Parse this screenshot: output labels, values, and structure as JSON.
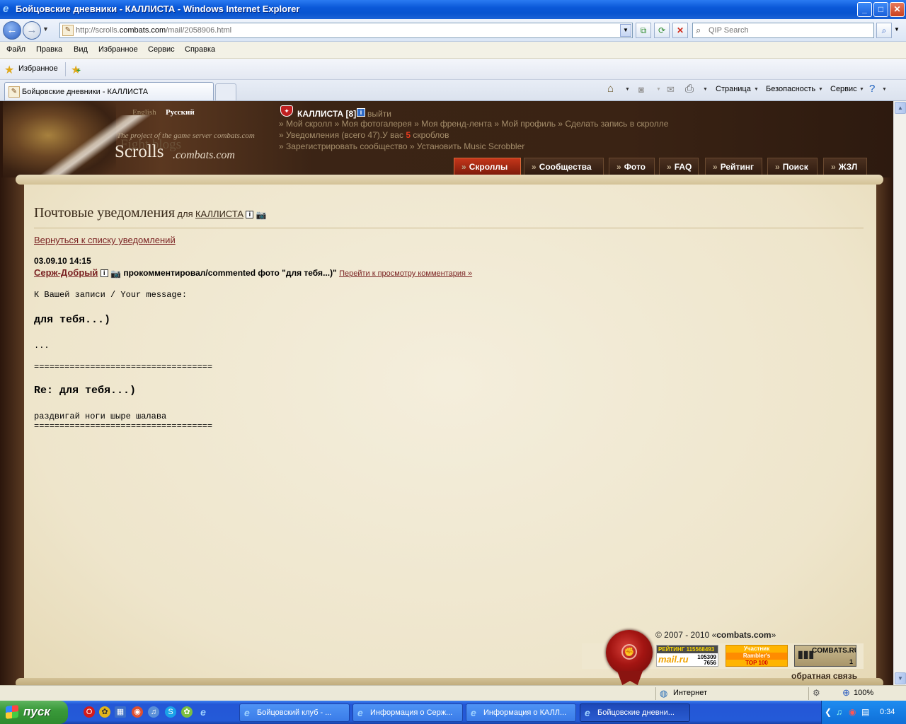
{
  "window": {
    "title": "Бойцовские дневники - КАЛЛИСТА - Windows Internet Explorer",
    "minimize": "_",
    "maximize": "□",
    "close": "✕"
  },
  "address": {
    "url_prefix": "http://scrolls.",
    "url_domain": "combats.com",
    "url_suffix": "/mail/2058906.html",
    "search_placeholder": "QIP Search"
  },
  "menu": [
    "Файл",
    "Правка",
    "Вид",
    "Избранное",
    "Сервис",
    "Справка"
  ],
  "favorites": {
    "label": "Избранное"
  },
  "tabs": [
    {
      "label": "Бойцовские дневники - КАЛЛИСТА"
    }
  ],
  "commandbar": {
    "page": "Страница",
    "safety": "Безопасность",
    "tools": "Сервис"
  },
  "site": {
    "lang_en": "English",
    "lang_ru": "Русский",
    "logo_project": "The project of the game server combats.com",
    "logo_fight": "Fight blogs",
    "logo_scrolls": "Scrolls",
    "logo_domain": ".combats.com",
    "user_name": "КАЛЛИСТА [8]",
    "user_info": "i",
    "logout": "выйти",
    "links1": [
      "Мой скролл",
      "Моя фотогалерея",
      "Моя френд-лента",
      "Мой профиль",
      "Сделать запись в скролле"
    ],
    "notif_text": "Уведомления (всего 47).",
    "have_text": "У вас",
    "scrob_count": "5",
    "scrob_word": "скроблов",
    "links3": [
      "Зарегистрировать сообщество",
      "Установить Music Scrobbler"
    ],
    "nav": [
      "Скроллы",
      "Сообщества",
      "Фото",
      "FAQ",
      "Рейтинг",
      "Поиск",
      "ЖЗЛ"
    ],
    "arrow": "»"
  },
  "content": {
    "heading": "Почтовые уведомления",
    "for": "для",
    "for_user": "КАЛЛИСТА",
    "back_link": "Вернуться к списку уведомлений",
    "date": "03.09.10 14:15",
    "author": "Серж-Добрый",
    "action": "прокомментировал/commented фото \"для тебя...)\"",
    "view_link": "Перейти к просмотру комментария »",
    "to_your": "К Вашей записи / Your message:",
    "post_title": "для тебя...)",
    "ellipsis": "...",
    "divider": "===================================",
    "reply_title": "Re: для тебя...)",
    "reply_text": "раздвигай ноги шыре шалава"
  },
  "footer": {
    "copyright_pre": "© 2007 - 2010 «",
    "copyright_brand": "combats.com",
    "copyright_post": "»",
    "feedback": "обратная связь",
    "mail_counter": {
      "hdr": "РЕЙТИНГ 115568493",
      "brand": "mail.ru",
      "n1": "105309",
      "n2": "7656"
    },
    "rambler": {
      "l1": "Участник",
      "l2": "Rambler's",
      "l3": "TOP 100"
    },
    "combats_counter": {
      "brand": "COMBATS.RU",
      "num": "1"
    }
  },
  "status": {
    "zone": "Интернет",
    "zoom": "100%"
  },
  "taskbar": {
    "start": "пуск",
    "buttons": [
      "Бойцовский клуб - ...",
      "Информация о Серж...",
      "Информация о КАЛЛ...",
      "Бойцовские дневни..."
    ],
    "clock": "0:34"
  },
  "colors": {
    "accent_red": "#c5361a",
    "link": "#7a2222",
    "parchment": "#f1ead5",
    "header_bg": "#3a2314"
  }
}
